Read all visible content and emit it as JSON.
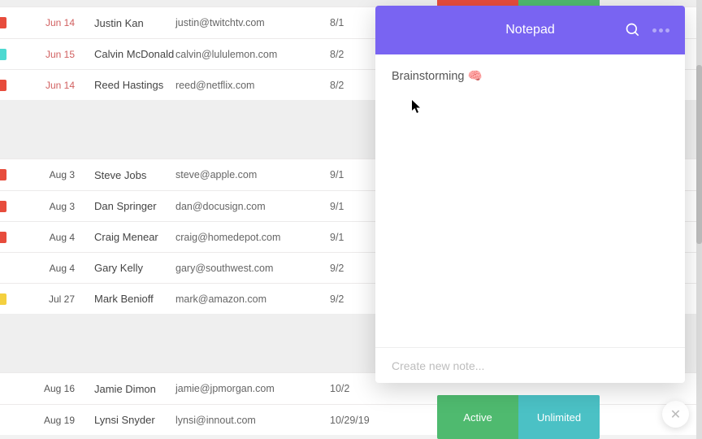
{
  "notepad": {
    "title": "Notepad",
    "note": "Brainstorming 🧠",
    "create_placeholder": "Create new note..."
  },
  "status": {
    "left": "Active",
    "right": "Unlimited"
  },
  "groups": {
    "g1": [
      {
        "flag": "red",
        "date": "Jun 14",
        "name": "Justin Kan",
        "email": "justin@twitchtv.com",
        "due": "8/1"
      },
      {
        "flag": "teal",
        "date": "Jun 15",
        "name": "Calvin McDonald",
        "email": "calvin@lululemon.com",
        "due": "8/2"
      },
      {
        "flag": "red",
        "date": "Jun 14",
        "name": "Reed Hastings",
        "email": "reed@netflix.com",
        "due": "8/2"
      }
    ],
    "g2": [
      {
        "flag": "red",
        "date": "Aug 3",
        "name": "Steve Jobs",
        "email": "steve@apple.com",
        "due": "9/1"
      },
      {
        "flag": "red",
        "date": "Aug 3",
        "name": "Dan Springer",
        "email": "dan@docusign.com",
        "due": "9/1"
      },
      {
        "flag": "red",
        "date": "Aug 4",
        "name": "Craig Menear",
        "email": "craig@homedepot.com",
        "due": "9/1"
      },
      {
        "flag": "",
        "date": "Aug 4",
        "name": "Gary Kelly",
        "email": "gary@southwest.com",
        "due": "9/2"
      },
      {
        "flag": "yellow",
        "date": "Jul 27",
        "name": "Mark Benioff",
        "email": "mark@amazon.com",
        "due": "9/2"
      }
    ],
    "g3": [
      {
        "flag": "",
        "date": "Aug 16",
        "name": "Jamie Dimon",
        "email": "jamie@jpmorgan.com",
        "due": "10/2"
      },
      {
        "flag": "",
        "date": "Aug 19",
        "name": "Lynsi Snyder",
        "email": "lynsi@innout.com",
        "due": "10/29/19"
      }
    ]
  }
}
